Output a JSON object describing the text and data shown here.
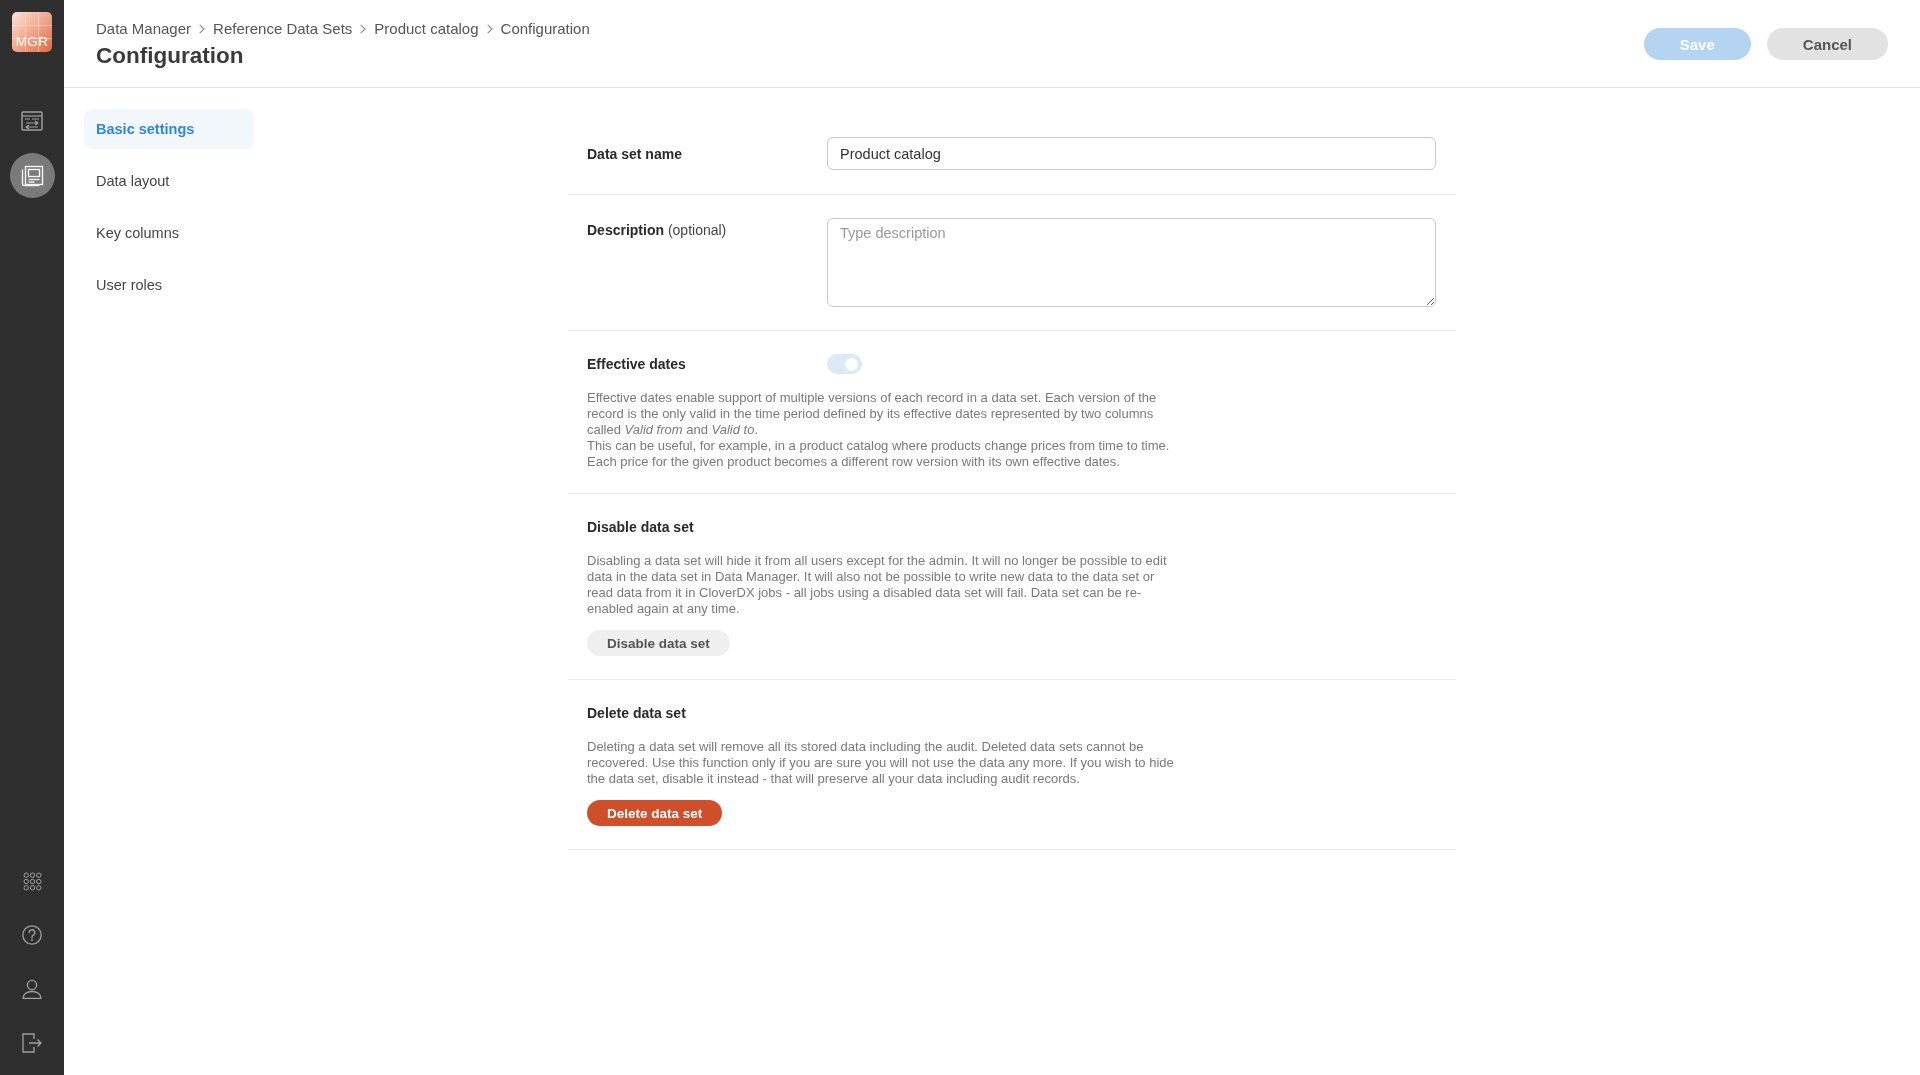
{
  "sidebar": {
    "logo": "MGR",
    "nav": [
      {
        "kind": "table",
        "selected": false
      },
      {
        "kind": "document",
        "selected": true
      }
    ]
  },
  "header": {
    "breadcrumbs": [
      "Data Manager",
      "Reference Data Sets",
      "Product catalog",
      "Configuration"
    ],
    "title": "Configuration",
    "buttons": [
      {
        "label": "Save",
        "kind": "primary",
        "disabled": true
      },
      {
        "label": "Cancel",
        "kind": "secondary",
        "disabled": false
      }
    ]
  },
  "settings_nav": [
    {
      "label": "Basic settings",
      "selected": true
    },
    {
      "label": "Data layout",
      "selected": false
    },
    {
      "label": "Key columns",
      "selected": false
    },
    {
      "label": "User roles",
      "selected": false
    }
  ],
  "form": {
    "sections": [
      {
        "kind": "input",
        "label": "Data set name",
        "value": "Product catalog"
      },
      {
        "kind": "textarea",
        "label": "Description",
        "note": "(optional)",
        "placeholder": "Type description"
      },
      {
        "kind": "toggle",
        "title": "Effective dates",
        "on": true,
        "disabled": true,
        "text": [
          "Effective dates enable support of multiple versions of each record in a data set. Each version of the record is the only valid in the time period defined by its effective dates represented by two columns called *Valid from* and *Valid to*.",
          "This can be useful, for example, in a product catalog where products change prices from time to time. Each price for the given product becomes a different row version with its own effective dates."
        ]
      },
      {
        "kind": "action",
        "title": "Disable data set",
        "text": [
          "Disabling a data set will hide it from all users except for the admin. It will no longer be possible to edit data in the data set in Data Manager. It will also not be possible to write new data to the data set or read data from it in CloverDX jobs - all jobs using a disabled data set will fail. Data set can be re-enabled again at any time."
        ],
        "button": {
          "label": "Disable data set",
          "kind": "secondary"
        }
      },
      {
        "kind": "action",
        "title": "Delete data set",
        "text": [
          "Deleting a data set will remove all its stored data including the audit. Deleted data sets cannot be recovered. Use this function only if you are sure you will not use the data any more. If you wish to hide the data set, disable it instead - that will preserve all your data including audit records."
        ],
        "button": {
          "label": "Delete data set",
          "kind": "danger"
        }
      }
    ]
  }
}
